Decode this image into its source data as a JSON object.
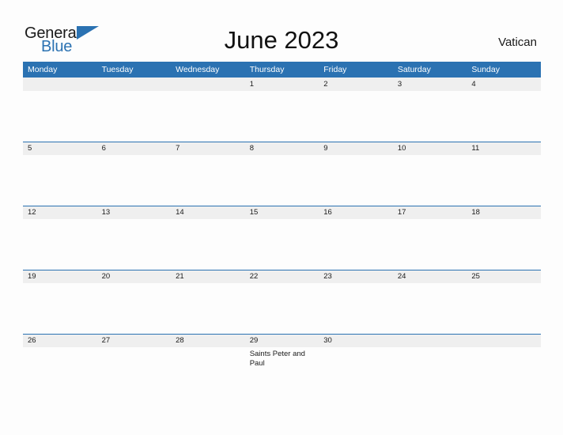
{
  "brand": {
    "name_part1": "General",
    "name_part2": "Blue",
    "flag_icon": "triangle-flag-icon",
    "accent_color": "#2b72b2"
  },
  "header": {
    "title": "June 2023",
    "country": "Vatican"
  },
  "calendar": {
    "month": "June",
    "year": "2023",
    "weekday_headers": [
      "Monday",
      "Tuesday",
      "Wednesday",
      "Thursday",
      "Friday",
      "Saturday",
      "Sunday"
    ],
    "colors": {
      "header_bg": "#2b72b2",
      "header_text": "#ffffff",
      "daystrip_bg": "#efefef",
      "cell_bg": "#fdfdfd",
      "rule": "#2b72b2",
      "text": "#1a1a1a"
    },
    "weeks": [
      [
        {
          "day": "",
          "event": ""
        },
        {
          "day": "",
          "event": ""
        },
        {
          "day": "",
          "event": ""
        },
        {
          "day": "1",
          "event": ""
        },
        {
          "day": "2",
          "event": ""
        },
        {
          "day": "3",
          "event": ""
        },
        {
          "day": "4",
          "event": ""
        }
      ],
      [
        {
          "day": "5",
          "event": ""
        },
        {
          "day": "6",
          "event": ""
        },
        {
          "day": "7",
          "event": ""
        },
        {
          "day": "8",
          "event": ""
        },
        {
          "day": "9",
          "event": ""
        },
        {
          "day": "10",
          "event": ""
        },
        {
          "day": "11",
          "event": ""
        }
      ],
      [
        {
          "day": "12",
          "event": ""
        },
        {
          "day": "13",
          "event": ""
        },
        {
          "day": "14",
          "event": ""
        },
        {
          "day": "15",
          "event": ""
        },
        {
          "day": "16",
          "event": ""
        },
        {
          "day": "17",
          "event": ""
        },
        {
          "day": "18",
          "event": ""
        }
      ],
      [
        {
          "day": "19",
          "event": ""
        },
        {
          "day": "20",
          "event": ""
        },
        {
          "day": "21",
          "event": ""
        },
        {
          "day": "22",
          "event": ""
        },
        {
          "day": "23",
          "event": ""
        },
        {
          "day": "24",
          "event": ""
        },
        {
          "day": "25",
          "event": ""
        }
      ],
      [
        {
          "day": "26",
          "event": ""
        },
        {
          "day": "27",
          "event": ""
        },
        {
          "day": "28",
          "event": ""
        },
        {
          "day": "29",
          "event": "Saints Peter and Paul"
        },
        {
          "day": "30",
          "event": ""
        },
        {
          "day": "",
          "event": ""
        },
        {
          "day": "",
          "event": ""
        }
      ]
    ]
  }
}
